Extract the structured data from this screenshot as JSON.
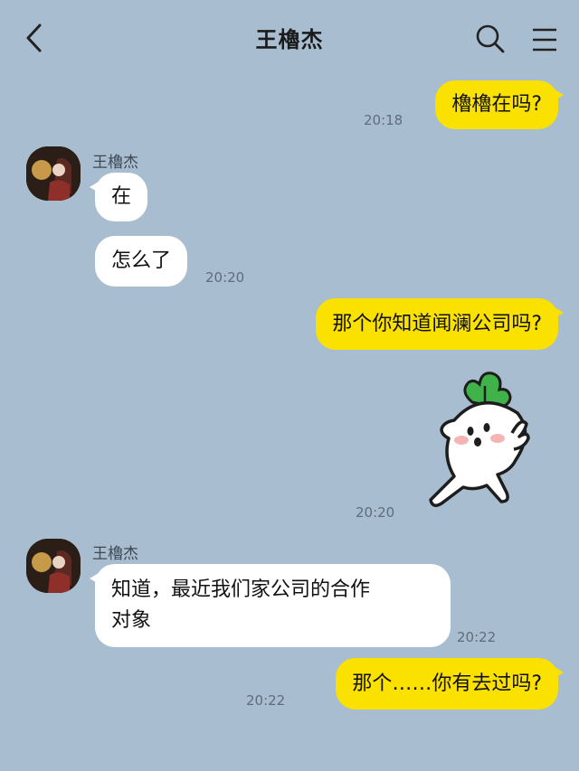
{
  "header": {
    "title": "王櫓杰",
    "back_icon": "chevron-left-icon",
    "search_icon": "search-icon",
    "menu_icon": "menu-icon"
  },
  "contact_name": "王櫓杰",
  "messages": [
    {
      "from": "me",
      "text": "櫓櫓在吗?",
      "time": "20:18"
    },
    {
      "from": "them",
      "text": "在"
    },
    {
      "from": "them",
      "text": "怎么了",
      "time": "20:20"
    },
    {
      "from": "me",
      "text": "那个你知道闻澜公司吗?"
    },
    {
      "from": "me",
      "type": "sticker",
      "sticker": "radish-waving-sticker",
      "time": "20:20"
    },
    {
      "from": "them",
      "text_line1": "知道，最近我们家公司的合作",
      "text_line2": "对象",
      "time": "20:22"
    },
    {
      "from": "me",
      "text": "那个……你有去过吗?",
      "time": "20:22"
    }
  ],
  "colors": {
    "background": "#a9bdd0",
    "my_bubble": "#fae100",
    "their_bubble": "#ffffff"
  }
}
